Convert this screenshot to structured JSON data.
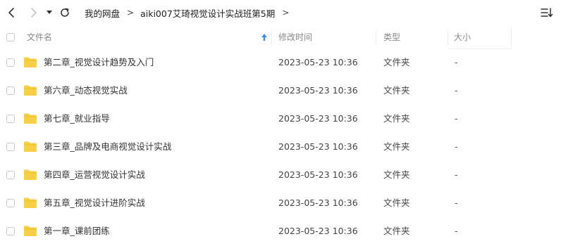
{
  "toolbar": {
    "breadcrumbs": [
      {
        "label": "我的网盘"
      },
      {
        "label": "aiki007艾琦视觉设计实战班第5期"
      }
    ]
  },
  "columns": {
    "name": "文件名",
    "modified": "修改时间",
    "type": "类型",
    "size": "大小"
  },
  "files": [
    {
      "name": "第二章_视觉设计趋势及入门",
      "modified": "2023-05-23 10:36",
      "type": "文件夹",
      "size": "-"
    },
    {
      "name": "第六章_动态视觉实战",
      "modified": "2023-05-23 10:36",
      "type": "文件夹",
      "size": "-"
    },
    {
      "name": "第七章_就业指导",
      "modified": "2023-05-23 10:36",
      "type": "文件夹",
      "size": "-"
    },
    {
      "name": "第三章_品牌及电商视觉设计实战",
      "modified": "2023-05-23 10:36",
      "type": "文件夹",
      "size": "-"
    },
    {
      "name": "第四章_运营视觉设计实战",
      "modified": "2023-05-23 10:36",
      "type": "文件夹",
      "size": "-"
    },
    {
      "name": "第五章_视觉设计进阶实战",
      "modified": "2023-05-23 10:36",
      "type": "文件夹",
      "size": "-"
    },
    {
      "name": "第一章_课前团练",
      "modified": "2023-05-23 10:36",
      "type": "文件夹",
      "size": "-"
    }
  ],
  "icons": {
    "back": "chevron-left-icon",
    "forward": "chevron-right-icon",
    "history": "caret-down-icon",
    "refresh": "refresh-icon",
    "sort_view": "sort-list-icon",
    "column_sort": "sort-arrow-up-icon",
    "folder": "folder-icon"
  },
  "colors": {
    "folder": "#F8CE45",
    "sort_arrow": "#3D8FEF",
    "header_text": "#888888"
  }
}
